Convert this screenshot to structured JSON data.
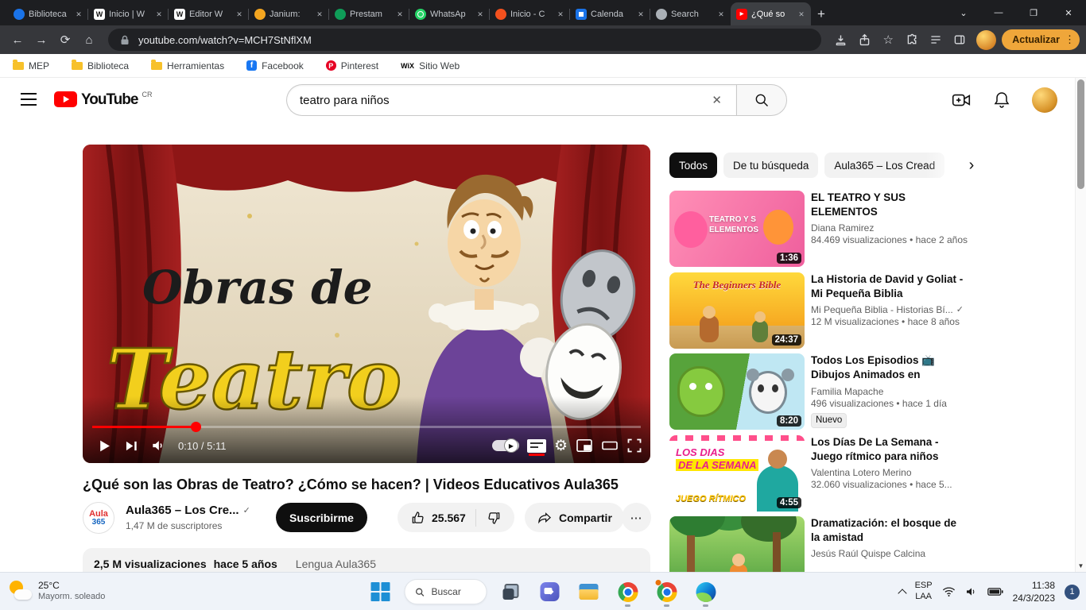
{
  "icons": {
    "close": "✕",
    "minimize": "—",
    "maximize": "❐",
    "tab_search": "⌄",
    "new_tab": "+",
    "back": "←",
    "forward": "→",
    "reload": "⟳",
    "home": "⌂",
    "star": "☆",
    "menu_dots": "⋮",
    "more_horiz": "⋯",
    "verified": "✓",
    "clear": "✕",
    "chevron_right": "›",
    "scroll_down": "▼",
    "play": "▶",
    "gear": "⚙"
  },
  "browser": {
    "tabs": [
      {
        "title": "Biblioteca"
      },
      {
        "title": "Inicio | W"
      },
      {
        "title": "Editor W"
      },
      {
        "title": "Janium:"
      },
      {
        "title": "Prestam"
      },
      {
        "title": "WhatsAp"
      },
      {
        "title": "Inicio - C"
      },
      {
        "title": "Calenda"
      },
      {
        "title": "Search"
      },
      {
        "title": "¿Qué so"
      }
    ],
    "url": "youtube.com/watch?v=MCH7StNflXM",
    "update_label": "Actualizar",
    "bookmarks": [
      {
        "label": "MEP"
      },
      {
        "label": "Biblioteca"
      },
      {
        "label": "Herramientas"
      },
      {
        "label": "Facebook"
      },
      {
        "label": "Pinterest"
      },
      {
        "label": "Sitio Web"
      }
    ]
  },
  "youtube": {
    "logo": "YouTube",
    "logo_country": "CR",
    "search_value": "teatro para niños",
    "player": {
      "overlay_line1": "Obras de",
      "overlay_line2": "Teatro",
      "time": "0:10 / 5:11",
      "progress_style": "width:19%"
    },
    "video": {
      "title": "¿Qué son las Obras de Teatro? ¿Cómo se hacen? | Videos Educativos Aula365",
      "channel_name": "Aula365 – Los Cre...",
      "avatar_line1": "Aula",
      "avatar_line2": "365",
      "subscribers": "1,47 M de suscriptores",
      "subscribe_label": "Suscribirme",
      "like_count": "25.567",
      "share_label": "Compartir",
      "views": "2,5 M visualizaciones",
      "uploaded": "hace 5 años",
      "description_link": "Lengua Aula365"
    },
    "chips": [
      {
        "label": "Todos"
      },
      {
        "label": "De tu búsqueda"
      },
      {
        "label": "Aula365 – Los Cread"
      }
    ],
    "related": [
      {
        "title": "EL TEATRO Y SUS ELEMENTOS",
        "channel": "Diana Ramirez",
        "meta": "84.469 visualizaciones • hace 2 años",
        "duration": "1:36",
        "thumb_line1": "TEATRO Y S",
        "thumb_line2": "ELEMENTOS"
      },
      {
        "title": "La Historia de David y Goliat - Mi Pequeña Biblia",
        "channel": "Mi Pequeña Biblia - Historias Bí...",
        "meta": "12 M visualizaciones • hace 8 años",
        "duration": "24:37",
        "thumb_line1": "The Beginners Bible"
      },
      {
        "title": "Todos Los Episodios 📺 Dibujos Animados en Español!...",
        "channel": "Familia Mapache",
        "meta": "496 visualizaciones • hace 1 día",
        "duration": "8:20",
        "badge": "Nuevo"
      },
      {
        "title": "Los Días De La Semana - Juego rítmico para niños",
        "channel": "Valentina Lotero Merino",
        "meta": "32.060 visualizaciones • hace 5...",
        "duration": "4:55",
        "thumb_line1": "LOS DIAS",
        "thumb_line2": "DE LA SEMANA",
        "thumb_line3": "JUEGO RÍTMICO"
      },
      {
        "title": "Dramatización: el bosque de la amistad",
        "channel": "Jesús Raúl Quispe Calcina",
        "meta": "",
        "duration": ""
      }
    ]
  },
  "taskbar": {
    "weather_temp": "25°C",
    "weather_desc": "Mayorm. soleado",
    "search_label": "Buscar",
    "lang_line1": "ESP",
    "lang_line2": "LAA",
    "time": "11:38",
    "date": "24/3/2023",
    "notification_count": "1"
  },
  "colors": {
    "yt_red": "#ff0000",
    "update_pill": "#efa63a",
    "chip_active": "#0f0f0f"
  }
}
